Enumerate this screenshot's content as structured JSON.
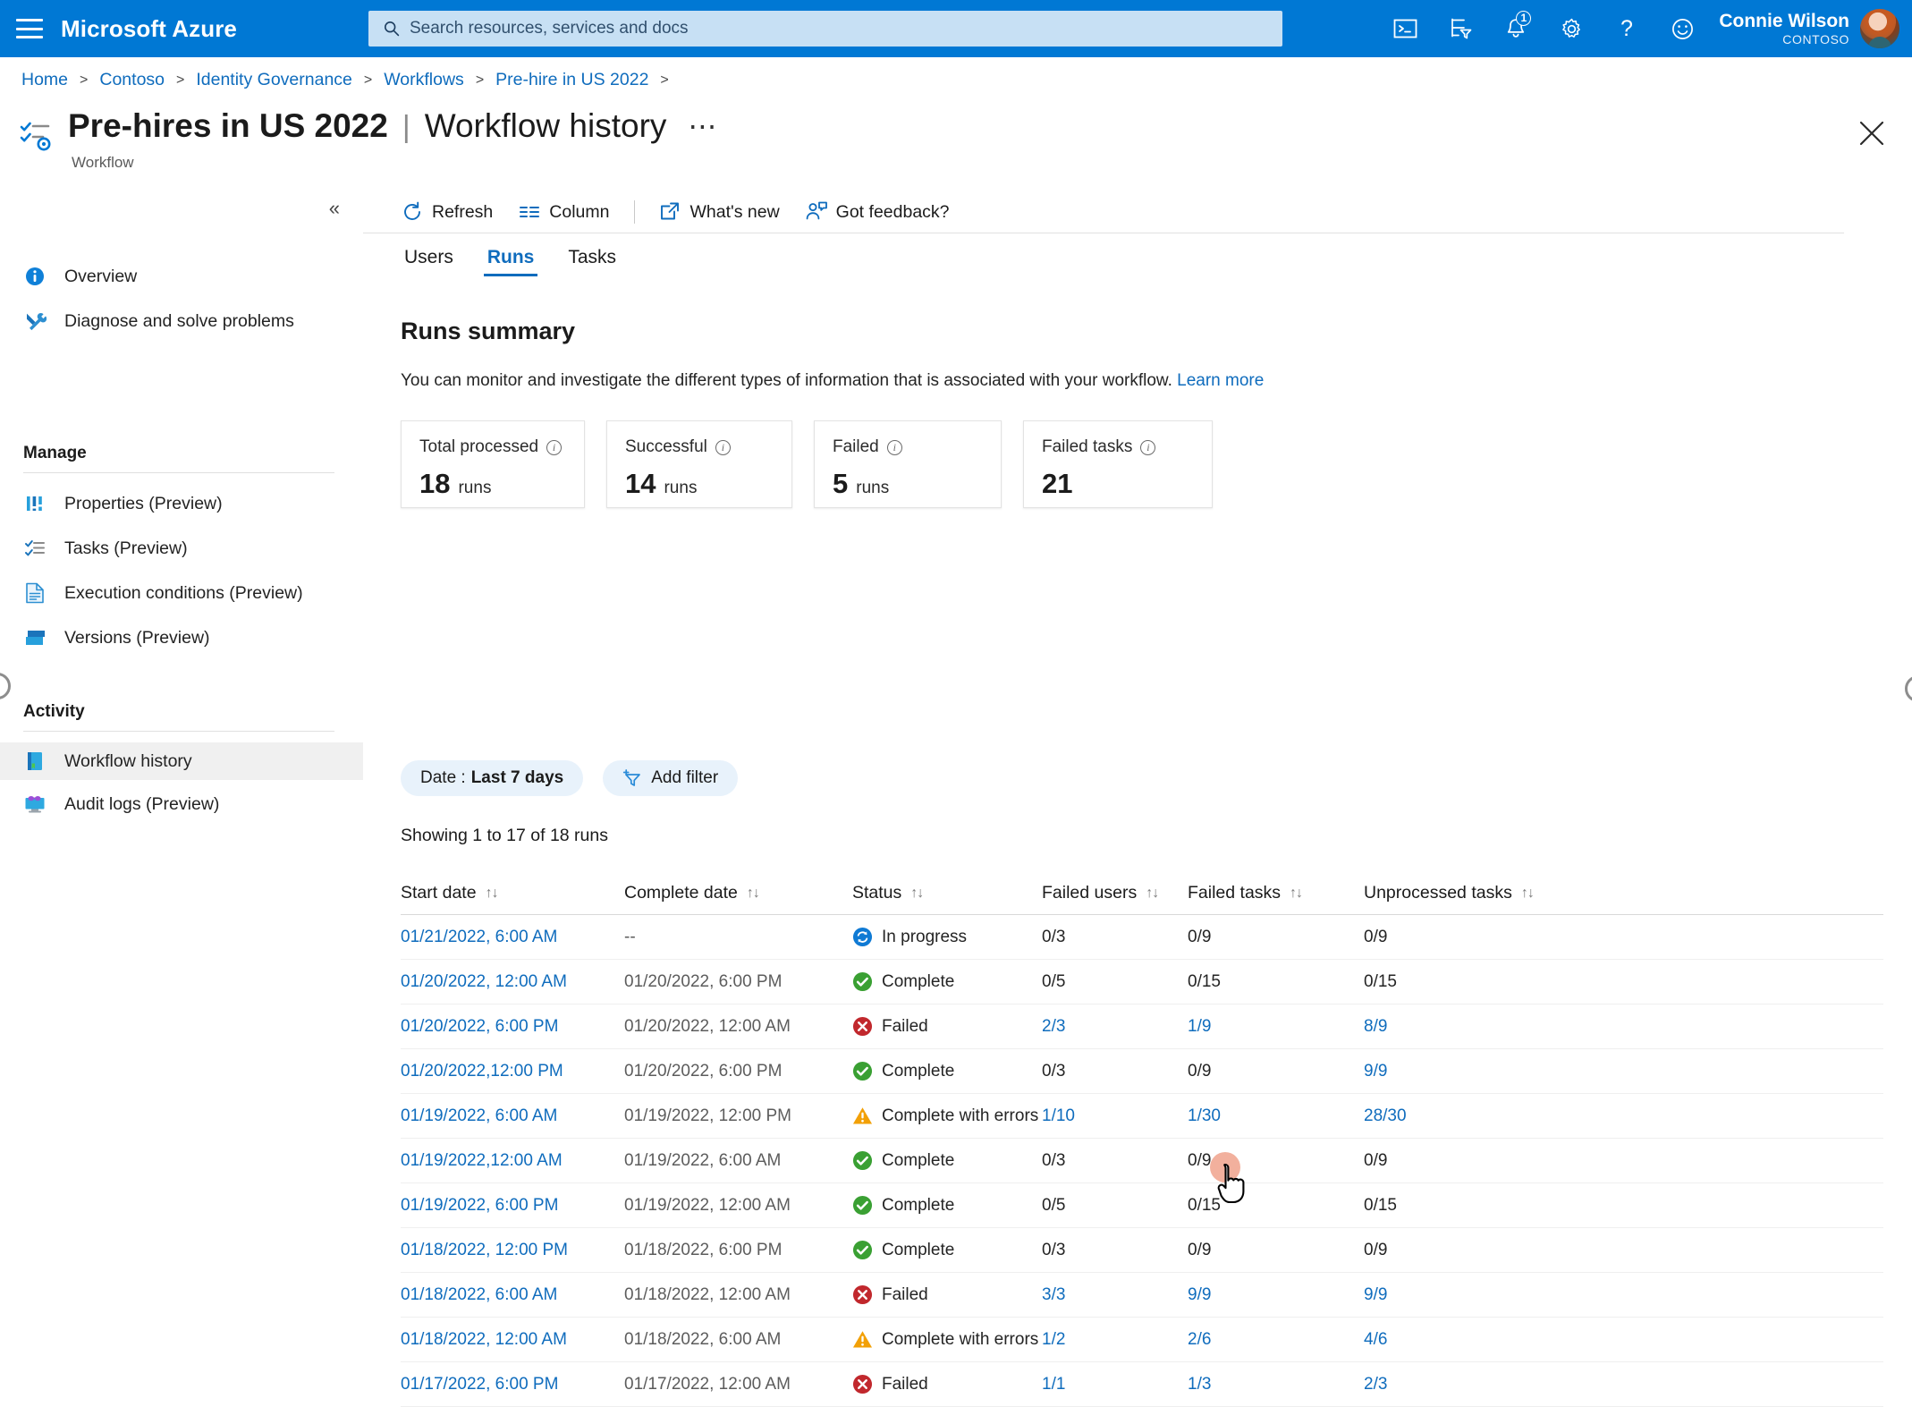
{
  "topbar": {
    "menu_icon": "hamburger-icon",
    "brand": "Microsoft Azure",
    "search_placeholder": "Search resources, services and docs",
    "icons": [
      {
        "name": "cloud-shell-icon",
        "label": "Cloud Shell"
      },
      {
        "name": "directories-filter-icon",
        "label": "Directories + subscriptions"
      },
      {
        "name": "notifications-icon",
        "label": "Notifications",
        "badge": "1"
      },
      {
        "name": "settings-gear-icon",
        "label": "Settings"
      },
      {
        "name": "help-question-icon",
        "label": "Help"
      },
      {
        "name": "feedback-smiley-icon",
        "label": "Feedback"
      }
    ],
    "user": {
      "name": "Connie Wilson",
      "org": "CONTOSO"
    }
  },
  "breadcrumb": [
    "Home",
    "Contoso",
    "Identity Governance",
    "Workflows",
    "Pre-hire in US 2022"
  ],
  "header": {
    "title": "Pre-hires in US 2022",
    "separator": "|",
    "subtitle": "Workflow history",
    "ellipsis": "⋯",
    "resource_type": "Workflow",
    "close_label": "Close"
  },
  "sidebar": {
    "collapse_label": "«",
    "top_items": [
      {
        "label": "Overview",
        "icon": "info-circle-icon",
        "selected": false
      },
      {
        "label": "Diagnose and solve problems",
        "icon": "wrench-screwdriver-icon",
        "selected": false
      }
    ],
    "groups": [
      {
        "title": "Manage",
        "items": [
          {
            "label": "Properties (Preview)",
            "icon": "properties-bars-icon",
            "selected": false
          },
          {
            "label": "Tasks (Preview)",
            "icon": "tasks-checklist-icon",
            "selected": false
          },
          {
            "label": "Execution conditions (Preview)",
            "icon": "document-icon",
            "selected": false
          },
          {
            "label": "Versions (Preview)",
            "icon": "versions-stack-icon",
            "selected": false
          }
        ]
      },
      {
        "title": "Activity",
        "items": [
          {
            "label": "Workflow history",
            "icon": "book-icon",
            "selected": true
          },
          {
            "label": "Audit logs (Preview)",
            "icon": "monitor-audit-icon",
            "selected": false
          }
        ]
      }
    ]
  },
  "toolbar": [
    {
      "label": "Refresh",
      "icon": "refresh-icon"
    },
    {
      "label": "Column",
      "icon": "columns-icon"
    },
    {
      "divider": true
    },
    {
      "label": "What's new",
      "icon": "external-link-icon"
    },
    {
      "label": "Got feedback?",
      "icon": "person-feedback-icon"
    }
  ],
  "tabs": [
    {
      "label": "Users",
      "active": false
    },
    {
      "label": "Runs",
      "active": true
    },
    {
      "label": "Tasks",
      "active": false
    }
  ],
  "main": {
    "section_title": "Runs summary",
    "description": "You can monitor and investigate the different types of information that is associated with your workflow.",
    "learn_more": "Learn more",
    "cards": [
      {
        "label": "Total processed",
        "value": "18",
        "unit": "runs",
        "info": "info-icon"
      },
      {
        "label": "Successful",
        "value": "14",
        "unit": "runs",
        "info": "info-icon"
      },
      {
        "label": "Failed",
        "value": "5",
        "unit": "runs",
        "info": "info-icon"
      },
      {
        "label": "Failed tasks",
        "value": "21",
        "unit": "",
        "info": "info-icon"
      }
    ],
    "filters": {
      "date_chip_label": "Date :",
      "date_chip_value": "Last 7 days",
      "add_filter_label": "Add filter"
    },
    "showing": "Showing 1 to 17 of 18 runs"
  },
  "table": {
    "columns": [
      "Start date",
      "Complete date",
      "Status",
      "Failed users",
      "Failed tasks",
      "Unprocessed tasks"
    ],
    "sort_glyph": "↑↓",
    "rows": [
      {
        "start": "01/21/2022, 6:00 AM",
        "complete": "--",
        "status": "In progress",
        "status_icon": "in-progress-icon",
        "failed_users": "0/3",
        "failed_users_link": false,
        "failed_tasks": "0/9",
        "failed_tasks_link": false,
        "unprocessed": "0/9",
        "unprocessed_link": false
      },
      {
        "start": "01/20/2022, 12:00 AM",
        "complete": "01/20/2022, 6:00 PM",
        "status": "Complete",
        "status_icon": "complete-icon",
        "failed_users": "0/5",
        "failed_users_link": false,
        "failed_tasks": "0/15",
        "failed_tasks_link": false,
        "unprocessed": "0/15",
        "unprocessed_link": false
      },
      {
        "start": "01/20/2022, 6:00 PM",
        "complete": "01/20/2022, 12:00 AM",
        "status": "Failed",
        "status_icon": "failed-icon",
        "failed_users": "2/3",
        "failed_users_link": true,
        "failed_tasks": "1/9",
        "failed_tasks_link": true,
        "unprocessed": "8/9",
        "unprocessed_link": true
      },
      {
        "start": "01/20/2022,12:00 PM",
        "complete": "01/20/2022, 6:00 PM",
        "status": "Complete",
        "status_icon": "complete-icon",
        "failed_users": "0/3",
        "failed_users_link": false,
        "failed_tasks": "0/9",
        "failed_tasks_link": false,
        "unprocessed": "9/9",
        "unprocessed_link": true
      },
      {
        "start": "01/19/2022, 6:00 AM",
        "complete": "01/19/2022, 12:00 PM",
        "status": "Complete with errors",
        "status_icon": "warning-icon",
        "failed_users": "1/10",
        "failed_users_link": true,
        "failed_tasks": "1/30",
        "failed_tasks_link": true,
        "unprocessed": "28/30",
        "unprocessed_link": true
      },
      {
        "start": "01/19/2022,12:00 AM",
        "complete": "01/19/2022, 6:00 AM",
        "status": "Complete",
        "status_icon": "complete-icon",
        "failed_users": "0/3",
        "failed_users_link": false,
        "failed_tasks": "0/9",
        "failed_tasks_link": false,
        "unprocessed": "0/9",
        "unprocessed_link": false
      },
      {
        "start": "01/19/2022, 6:00 PM",
        "complete": "01/19/2022, 12:00 AM",
        "status": "Complete",
        "status_icon": "complete-icon",
        "failed_users": "0/5",
        "failed_users_link": false,
        "failed_tasks": "0/15",
        "failed_tasks_link": false,
        "unprocessed": "0/15",
        "unprocessed_link": false
      },
      {
        "start": "01/18/2022, 12:00 PM",
        "complete": "01/18/2022, 6:00 PM",
        "status": "Complete",
        "status_icon": "complete-icon",
        "failed_users": "0/3",
        "failed_users_link": false,
        "failed_tasks": "0/9",
        "failed_tasks_link": false,
        "unprocessed": "0/9",
        "unprocessed_link": false
      },
      {
        "start": "01/18/2022, 6:00 AM",
        "complete": "01/18/2022, 12:00 AM",
        "status": "Failed",
        "status_icon": "failed-icon",
        "failed_users": "3/3",
        "failed_users_link": true,
        "failed_tasks": "9/9",
        "failed_tasks_link": true,
        "unprocessed": "9/9",
        "unprocessed_link": true
      },
      {
        "start": "01/18/2022, 12:00 AM",
        "complete": "01/18/2022, 6:00 AM",
        "status": "Complete with errors",
        "status_icon": "warning-icon",
        "failed_users": "1/2",
        "failed_users_link": true,
        "failed_tasks": "2/6",
        "failed_tasks_link": true,
        "unprocessed": "4/6",
        "unprocessed_link": true
      },
      {
        "start": "01/17/2022, 6:00 PM",
        "complete": "01/17/2022, 12:00 AM",
        "status": "Failed",
        "status_icon": "failed-icon",
        "failed_users": "1/1",
        "failed_users_link": true,
        "failed_tasks": "1/3",
        "failed_tasks_link": true,
        "unprocessed": "2/3",
        "unprocessed_link": true
      }
    ]
  },
  "colors": {
    "azure_blue": "#0078d4",
    "link_blue": "#0f6cbd",
    "success_green": "#3aa033",
    "error_red": "#c1282d",
    "warning_orange": "#f2a007",
    "search_bg": "#c7e0f4",
    "chip_bg": "#e8f2fb"
  }
}
